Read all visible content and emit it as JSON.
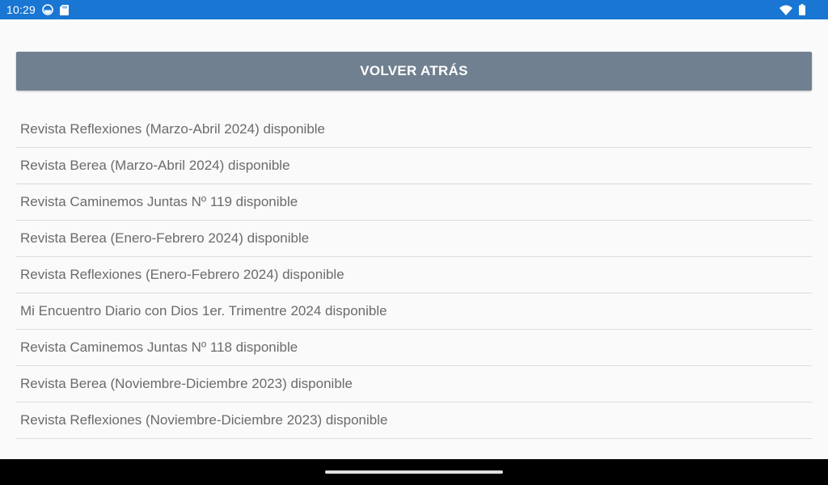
{
  "status_bar": {
    "time": "10:29",
    "background_color": "#1976d2",
    "left_icons": [
      "sync-icon",
      "sd-card-icon"
    ],
    "right_icons": [
      "wifi-icon",
      "battery-icon"
    ]
  },
  "back_button": {
    "label": "VOLVER ATRÁS",
    "background_color": "#708090"
  },
  "list": {
    "items": [
      {
        "label": "Revista Reflexiones (Marzo-Abril 2024) disponible"
      },
      {
        "label": "Revista Berea (Marzo-Abril 2024) disponible"
      },
      {
        "label": "Revista Caminemos Juntas Nº 119 disponible"
      },
      {
        "label": "Revista Berea (Enero-Febrero 2024) disponible"
      },
      {
        "label": "Revista Reflexiones (Enero-Febrero 2024) disponible"
      },
      {
        "label": "Mi Encuentro Diario con Dios 1er. Trimentre 2024 disponible"
      },
      {
        "label": "Revista Caminemos Juntas Nº 118 disponible"
      },
      {
        "label": "Revista Berea (Noviembre-Diciembre 2023) disponible"
      },
      {
        "label": "Revista Reflexiones (Noviembre-Diciembre 2023) disponible"
      }
    ]
  },
  "nav_bar": {
    "icons": [
      "home-handle"
    ]
  }
}
